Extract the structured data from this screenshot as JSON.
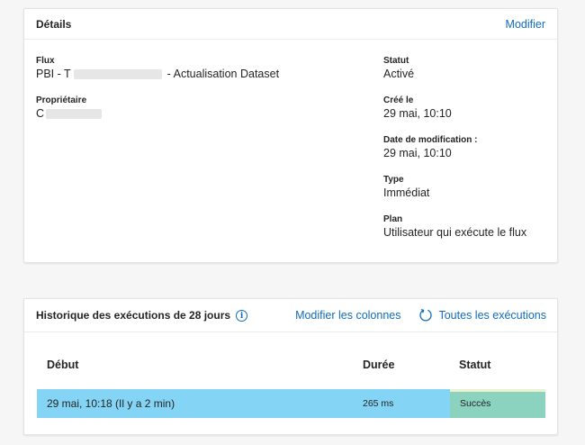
{
  "details": {
    "title": "Détails",
    "edit_label": "Modifier",
    "flow": {
      "label": "Flux",
      "prefix": "PBI - T",
      "suffix": "- Actualisation Dataset"
    },
    "owner": {
      "label": "Propriétaire",
      "prefix": "C"
    },
    "status": {
      "label": "Statut",
      "value": "Activé"
    },
    "created": {
      "label": "Créé le",
      "value": "29 mai, 10:10"
    },
    "modified": {
      "label": "Date de modification :",
      "value": "29 mai, 10:10"
    },
    "type": {
      "label": "Type",
      "value": "Immédiat"
    },
    "plan": {
      "label": "Plan",
      "value": "Utilisateur qui exécute le flux"
    }
  },
  "history": {
    "title": "Historique des exécutions de 28 jours",
    "info_icon": "info-icon",
    "edit_columns_label": "Modifier les colonnes",
    "all_runs_label": "Toutes les exécutions",
    "refresh_icon": "refresh-icon",
    "columns": {
      "start": "Début",
      "duration": "Durée",
      "status": "Statut"
    },
    "rows": [
      {
        "start": "29 mai, 10:18 (Il y a 2 min)",
        "duration": "265 ms",
        "status": "Succès"
      }
    ]
  },
  "colors": {
    "accent": "#0f6cbd",
    "row_highlight": "#84d4f5",
    "success": "#8bd3be"
  }
}
